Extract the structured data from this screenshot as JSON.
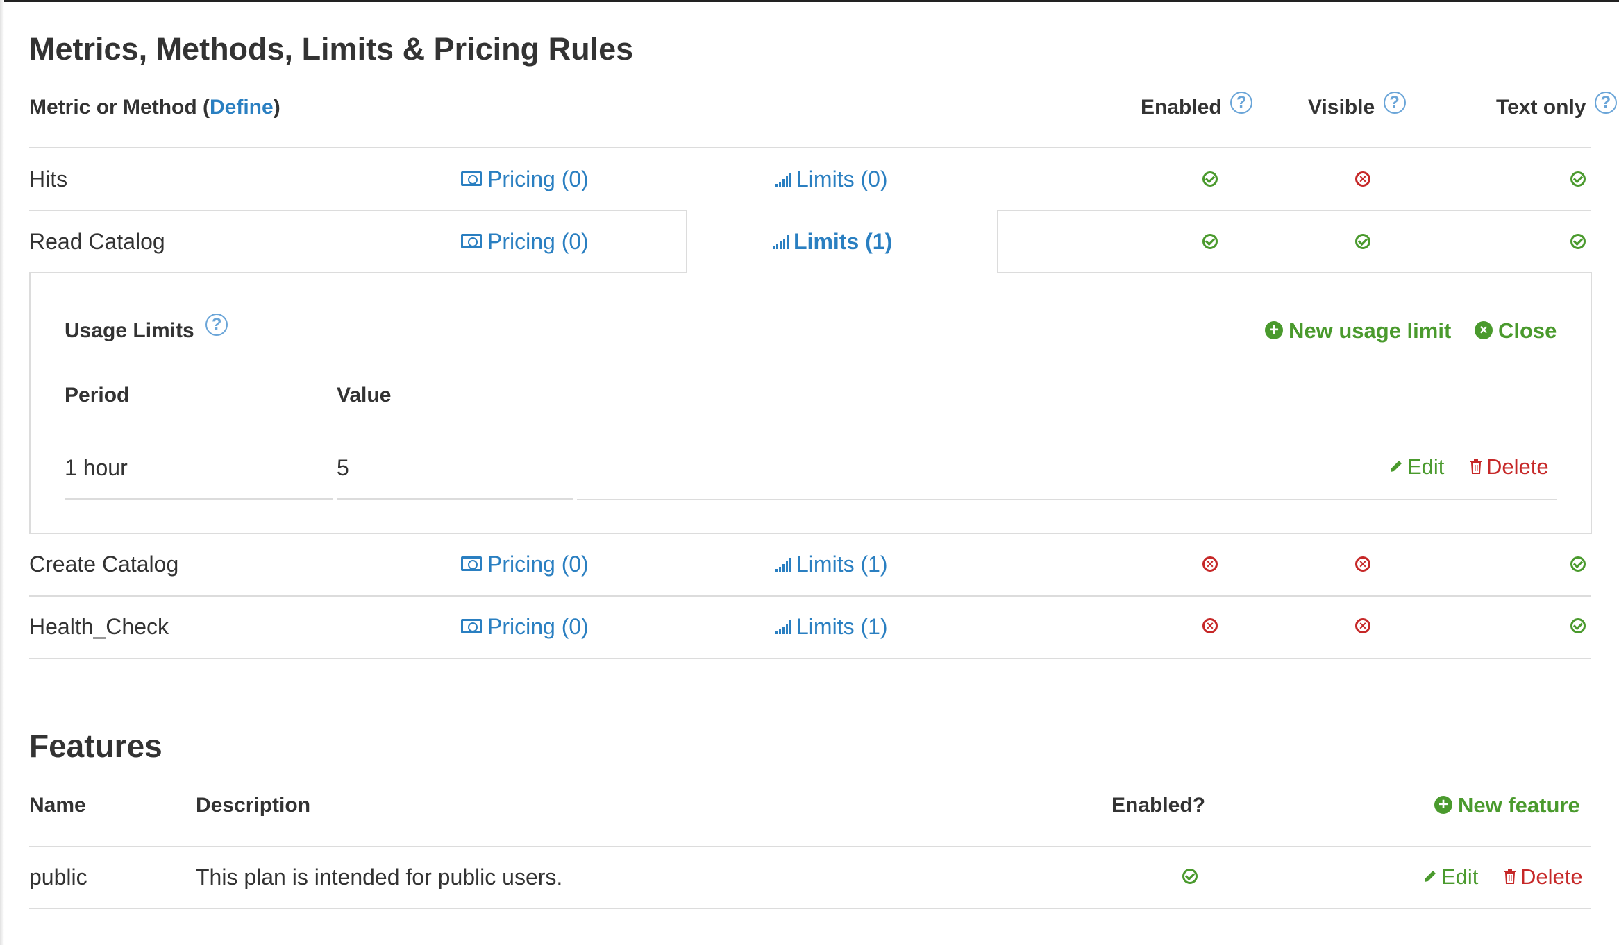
{
  "section_title": "Metrics, Methods, Limits & Pricing Rules",
  "metrics_header": {
    "prefix": "Metric or Method (",
    "define_link": "Define",
    "suffix": ")",
    "enabled": "Enabled",
    "visible": "Visible",
    "text_only": "Text only",
    "help_glyph": "?"
  },
  "metrics": [
    {
      "name": "Hits",
      "pricing": "Pricing (0)",
      "limits": "Limits (0)",
      "enabled": true,
      "visible": false,
      "text_only": true
    },
    {
      "name": "Read Catalog",
      "pricing": "Pricing (0)",
      "limits": "Limits (1)",
      "enabled": true,
      "visible": true,
      "text_only": true
    },
    {
      "name": "Create Catalog",
      "pricing": "Pricing (0)",
      "limits": "Limits (1)",
      "enabled": false,
      "visible": false,
      "text_only": true
    },
    {
      "name": "Health_Check",
      "pricing": "Pricing (0)",
      "limits": "Limits (1)",
      "enabled": false,
      "visible": false,
      "text_only": true
    }
  ],
  "usage_limits": {
    "title": "Usage Limits",
    "new_limit": "New usage limit",
    "close": "Close",
    "col_period": "Period",
    "col_value": "Value",
    "rows": [
      {
        "period": "1 hour",
        "value": "5",
        "edit": "Edit",
        "delete": "Delete"
      }
    ]
  },
  "features": {
    "title": "Features",
    "col_name": "Name",
    "col_description": "Description",
    "col_enabled": "Enabled?",
    "new_feature": "New feature",
    "rows": [
      {
        "name": "public",
        "description": "This plan is intended for public users.",
        "enabled": true,
        "edit": "Edit",
        "delete": "Delete"
      }
    ]
  },
  "colors": {
    "link": "#2a7fc1",
    "success": "#4a9a2d",
    "danger": "#c62828"
  },
  "icons": {
    "pricing": "money-icon",
    "limits": "signal-bars-icon",
    "help": "question-circle-icon",
    "ok": "check-circle-icon",
    "no": "x-circle-icon"
  }
}
